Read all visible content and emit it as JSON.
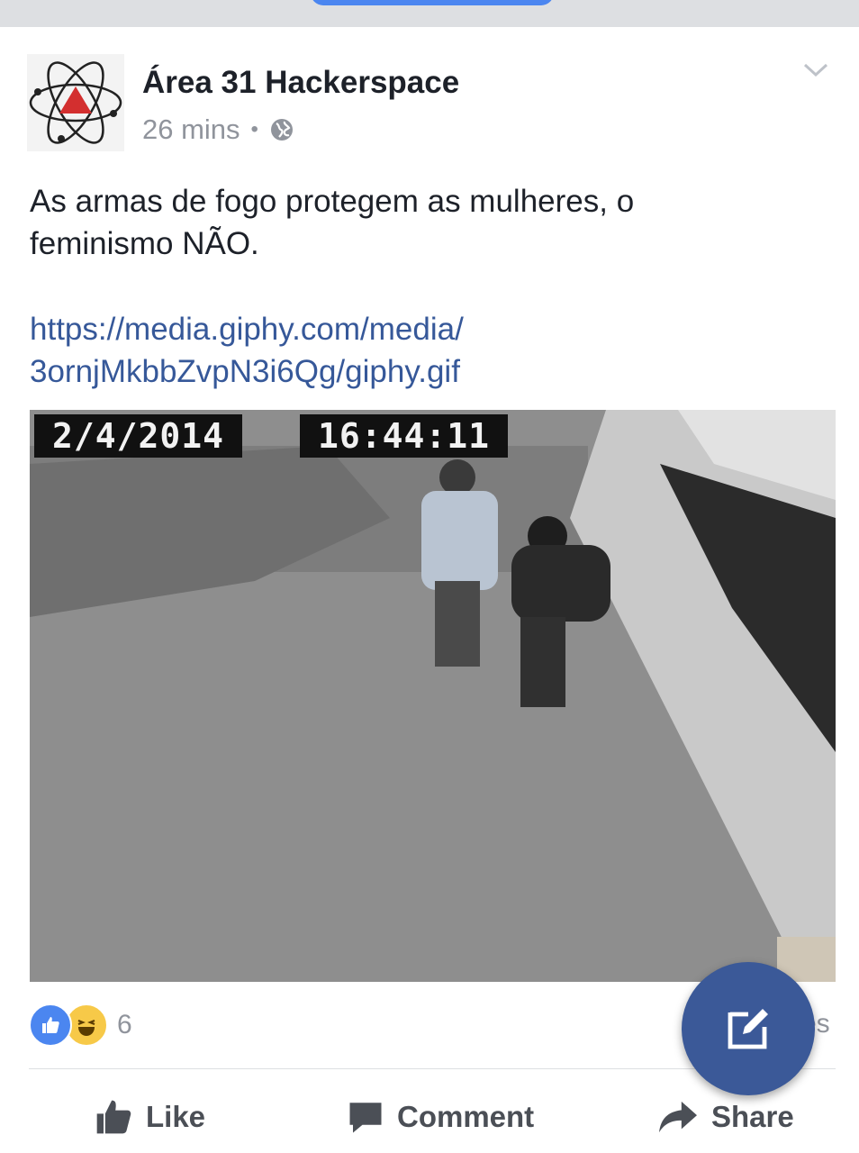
{
  "post": {
    "author": "Área 31 Hackerspace",
    "time": "26 mins",
    "separator": "•",
    "privacy_icon": "globe-icon",
    "text_line1": "As armas de fogo protegem as mulheres, o",
    "text_line2": "feminismo NÃO.",
    "link_line1": "https://media.giphy.com/media/",
    "link_line2": "3ornjMkbbZvpN3i6Qg/giphy.gif"
  },
  "media": {
    "date_stamp": "2/4/2014",
    "time_stamp": "16:44:11"
  },
  "reactions": {
    "icons": [
      "like-icon",
      "haha-icon"
    ],
    "count": "6",
    "shares_partial": "es"
  },
  "actions": {
    "like": "Like",
    "comment": "Comment",
    "share": "Share"
  },
  "colors": {
    "link": "#365899",
    "fab": "#3b5998",
    "like_blue": "#4b86f0",
    "meta_gray": "#90949c"
  }
}
